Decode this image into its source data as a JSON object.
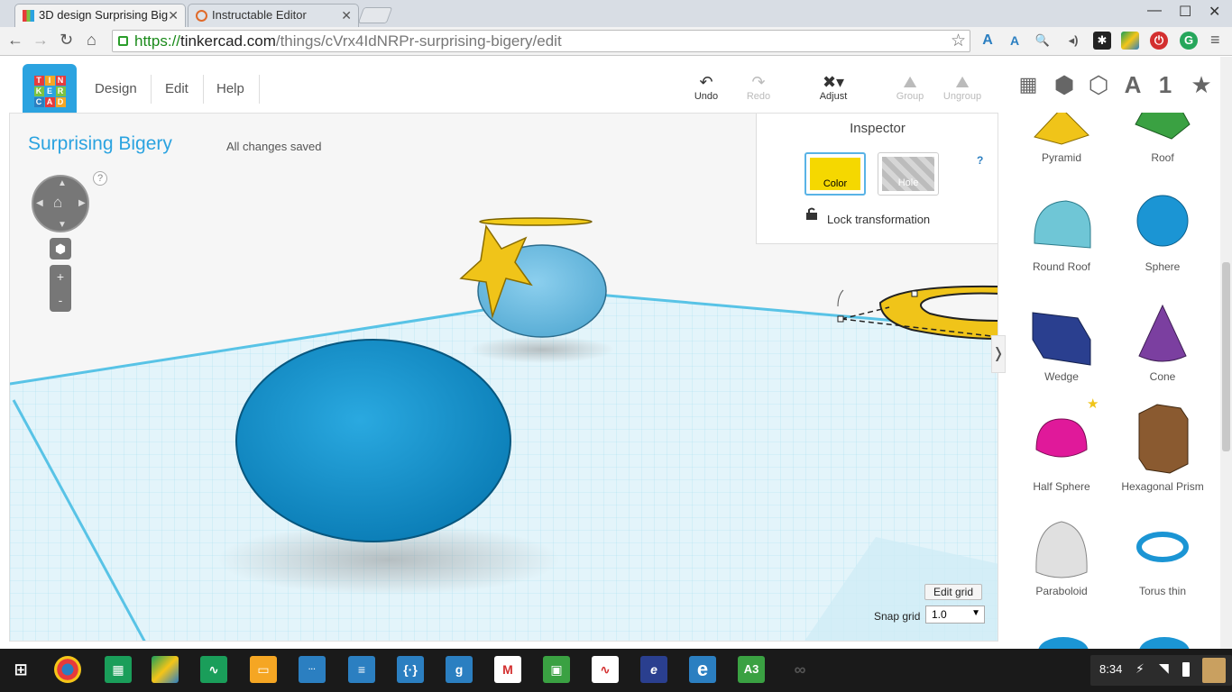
{
  "browser": {
    "tabs": [
      {
        "title": "3D design Surprising Big",
        "active": true
      },
      {
        "title": "Instructable Editor",
        "active": false
      }
    ],
    "url": {
      "scheme": "https://",
      "host": "tinkercad.com",
      "path": "/things/cVrx4IdNRPr-surprising-bigery/edit"
    }
  },
  "app": {
    "logo_letters": [
      "T",
      "I",
      "N",
      "K",
      "E",
      "R",
      "C",
      "A",
      "D"
    ],
    "menu": [
      "Design",
      "Edit",
      "Help"
    ],
    "tools": {
      "undo": "Undo",
      "redo": "Redo",
      "adjust": "Adjust",
      "group": "Group",
      "ungroup": "Ungroup"
    },
    "right_icons": {
      "letter": "A",
      "number": "1"
    }
  },
  "design": {
    "title": "Surprising Bigery",
    "save_status": "All changes saved",
    "help_q": "?"
  },
  "inspector": {
    "title": "Inspector",
    "color_label": "Color",
    "hole_label": "Hole",
    "help": "?",
    "lock_label": "Lock transformation",
    "color_value": "#f5d800"
  },
  "grid": {
    "edit_grid": "Edit grid",
    "snap_label": "Snap grid",
    "snap_value": "1.0"
  },
  "shapes": [
    {
      "label": "Pyramid",
      "color": "#f0c419"
    },
    {
      "label": "Roof",
      "color": "#3aa142"
    },
    {
      "label": "Round Roof",
      "color": "#6fc6d6"
    },
    {
      "label": "Sphere",
      "color": "#1b95d4"
    },
    {
      "label": "Wedge",
      "color": "#2a3f8f"
    },
    {
      "label": "Cone",
      "color": "#7b3fa0"
    },
    {
      "label": "Half Sphere",
      "color": "#e0199a"
    },
    {
      "label": "Hexagonal Prism",
      "color": "#8a5a30"
    },
    {
      "label": "Paraboloid",
      "color": "#e0e0e0"
    },
    {
      "label": "Torus thin",
      "color": "#1b95d4"
    }
  ],
  "taskbar": {
    "time": "8:34"
  }
}
